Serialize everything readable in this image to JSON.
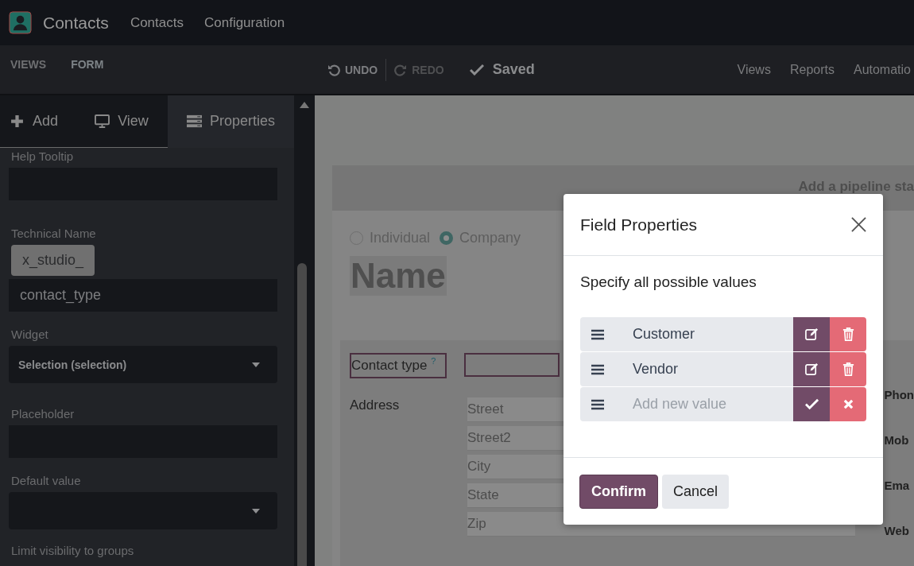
{
  "navbar": {
    "app_title": "Contacts",
    "menus": [
      "Contacts",
      "Configuration"
    ]
  },
  "studio_bar": {
    "tabs": [
      {
        "label": "VIEWS",
        "selected": false
      },
      {
        "label": "FORM",
        "selected": true
      }
    ],
    "undo": {
      "label": "UNDO",
      "disabled": false
    },
    "redo": {
      "label": "REDO",
      "disabled": true
    },
    "status": "Saved",
    "menus": [
      "Views",
      "Reports",
      "Automatio"
    ]
  },
  "sidebar": {
    "tabs": [
      {
        "kind": "add",
        "label": "Add",
        "selected": false
      },
      {
        "kind": "view",
        "label": "View",
        "selected": false
      },
      {
        "kind": "properties",
        "label": "Properties",
        "selected": true
      }
    ],
    "fields": [
      {
        "kind": "input",
        "label": "Help Tooltip"
      },
      {
        "kind": "prefixed",
        "label": "Technical Name",
        "prefix": "x_studio_",
        "value": "contact_type"
      },
      {
        "kind": "select",
        "label": "Widget",
        "value": "Selection (selection)"
      },
      {
        "kind": "input",
        "label": "Placeholder"
      },
      {
        "kind": "select",
        "label": "Default value"
      },
      {
        "kind": "heading",
        "label": "Limit visibility to groups"
      }
    ]
  },
  "form": {
    "banner": "Add a pipeline sta",
    "radios": [
      {
        "label": "Individual",
        "selected": false
      },
      {
        "label": "Company",
        "selected": true
      }
    ],
    "name_placeholder": "Name",
    "contact_type": {
      "label": "Contact type",
      "help": "?"
    },
    "address_label": "Address",
    "address_fields": [
      "Street",
      "Street2",
      "City",
      "State",
      "Zip"
    ],
    "right_labels": [
      "Phon",
      "Mob",
      "Ema",
      "Web"
    ]
  },
  "modal": {
    "title": "Field Properties",
    "prompt": "Specify all possible values",
    "values": [
      {
        "kind": "value",
        "label": "Customer"
      },
      {
        "kind": "value",
        "label": "Vendor"
      },
      {
        "kind": "new",
        "placeholder": "Add new value"
      }
    ],
    "confirm": "Confirm",
    "cancel": "Cancel"
  }
}
